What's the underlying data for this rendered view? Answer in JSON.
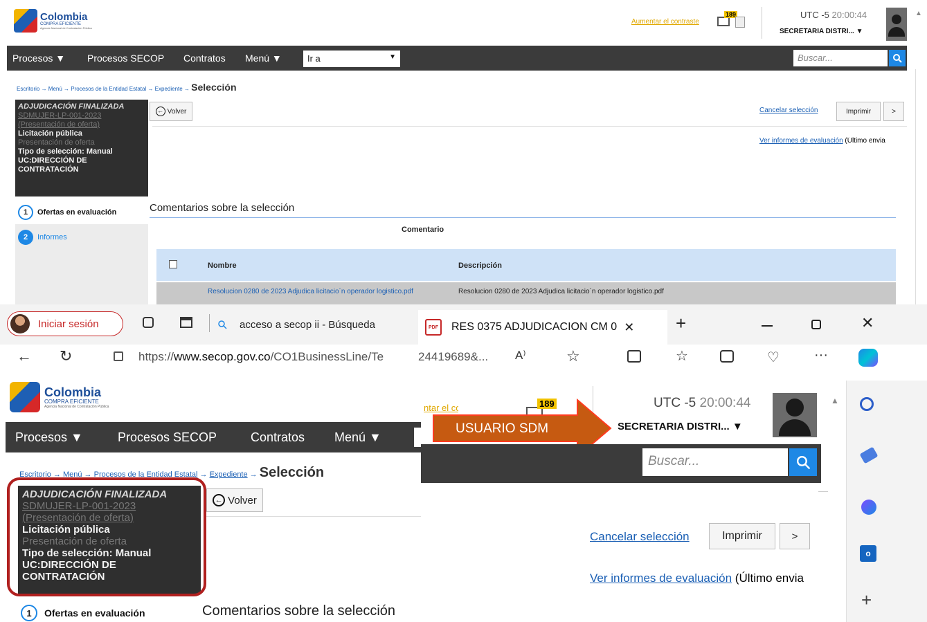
{
  "top": {
    "logo": {
      "name": "Colombia",
      "sub": "COMPRA EFICIENTE",
      "agency": "Agencia Nacional de Contratación Pública"
    },
    "contrast_link": "Aumentar el contraste",
    "mail_count": "189",
    "timezone": "UTC -5",
    "time": "20:00:44",
    "user": "SECRETARIA DISTRI...",
    "nav": {
      "procesos": "Procesos",
      "secop": "Procesos SECOP",
      "contratos": "Contratos",
      "menu": "Menú",
      "goto": "Ir a",
      "search_placeholder": "Buscar..."
    },
    "breadcrumb": {
      "b1": "Escritorio",
      "b2": "Menú",
      "b3": "Procesos de la Entidad Estatal",
      "b4": "Expediente",
      "current": "Selección"
    },
    "status": {
      "title": "ADJUDICACIÓN FINALIZADA",
      "code": "SDMUJER-LP-001-2023",
      "stage": "(Presentación de oferta)",
      "type": "Licitación pública",
      "stage2": "Presentación de oferta",
      "selection_label": "Tipo de selección:",
      "selection_value": "Manual",
      "unit": "UC:DIRECCIÓN DE CONTRATACIÓN"
    },
    "buttons": {
      "back": "Volver",
      "cancel": "Cancelar selección",
      "print": "Imprimir",
      "next": ">"
    },
    "reports_link": "Ver informes de evaluación",
    "reports_tail": "(Último envia",
    "steps": [
      {
        "num": "1",
        "label": "Ofertas en evaluación"
      },
      {
        "num": "2",
        "label": "Informes"
      }
    ],
    "comments_title": "Comentarios sobre la selección",
    "table": {
      "caption": "Comentario",
      "col_name": "Nombre",
      "col_desc": "Descripción",
      "row_name": "Resolucion 0280 de 2023 Adjudica licitacio´n operador logistico.pdf",
      "row_desc": "Resolucion 0280 de 2023 Adjudica licitacio´n operador logistico.pdf"
    }
  },
  "browser": {
    "signin": "Iniciar sesión",
    "tab_search": "acceso a secop ii - Búsqueda",
    "tab_pdf": "RES 0375 ADJUDICACION CM 0",
    "url_prefix": "https://",
    "url_host": "www.secop.gov.co",
    "url_path": "/CO1BusinessLine/Te",
    "url_tail": "24419689&...",
    "read_aloud": "A⁾",
    "arrow_label": "USUARIO SDM"
  },
  "colors": {
    "nav_bg": "#3b3b3b",
    "status_bg": "#2f2f2f",
    "accent": "#1e88e5",
    "arrow": "#c65a11",
    "highlight": "#b0201f",
    "contrast_link": "#e0a800"
  }
}
